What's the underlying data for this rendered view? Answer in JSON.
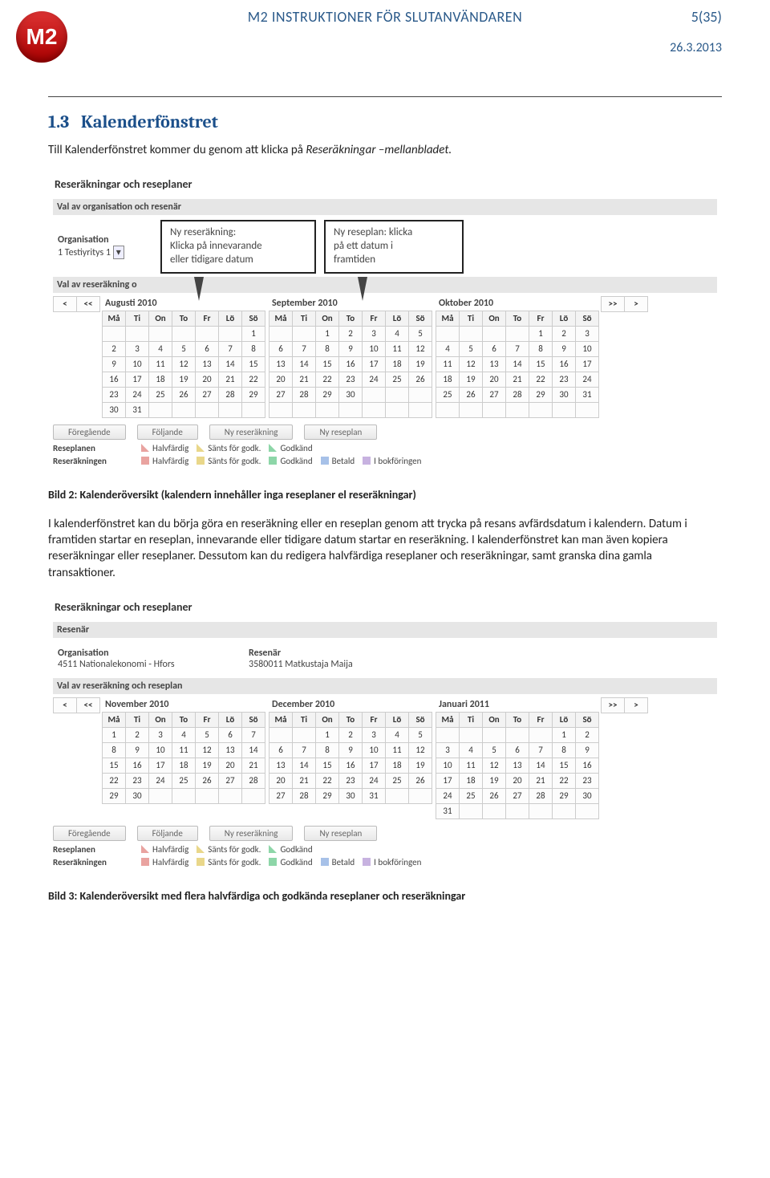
{
  "header": {
    "logo_text": "M2",
    "title": "M2 INSTRUKTIONER FÖR SLUTANVÄNDAREN",
    "page": "5(35)",
    "date": "26.3.2013"
  },
  "section": {
    "number": "1.3",
    "title": "Kalenderfönstret",
    "intro_pre": "Till Kalenderfönstret kommer du genom att klicka på ",
    "intro_em": "Reseräkningar –mellanbladet.",
    "intro_post": ""
  },
  "shot1": {
    "heading": "Reseräkningar och reseplaner",
    "subhead1": "Val av organisation och resenär",
    "org_label": "Organisation",
    "org_value": "1 Testiyritys 1",
    "pop1_l1": "Ny reseräkning:",
    "pop1_l2": "Klicka på innevarande",
    "pop1_l3": "eller tidigare datum",
    "pop2_l1": "Ny reseplan: klicka",
    "pop2_l2": "på ett datum i",
    "pop2_l3": "framtiden",
    "subhead2": "Val av reseräkning o",
    "months": [
      "Augusti 2010",
      "September 2010",
      "Oktober 2010"
    ],
    "dow": [
      "Må",
      "Ti",
      "On",
      "To",
      "Fr",
      "Lö",
      "Sö"
    ],
    "month_data": [
      [
        [
          "",
          "",
          "",
          "",
          "",
          "",
          "1"
        ],
        [
          "2",
          "3",
          "4",
          "5",
          "6",
          "7",
          "8"
        ],
        [
          "9",
          "10",
          "11",
          "12",
          "13",
          "14",
          "15"
        ],
        [
          "16",
          "17",
          "18",
          "19",
          "20",
          "21",
          "22"
        ],
        [
          "23",
          "24",
          "25",
          "26",
          "27",
          "28",
          "29"
        ],
        [
          "30",
          "31",
          "",
          "",
          "",
          "",
          ""
        ]
      ],
      [
        [
          "",
          "",
          "1",
          "2",
          "3",
          "4",
          "5"
        ],
        [
          "6",
          "7",
          "8",
          "9",
          "10",
          "11",
          "12"
        ],
        [
          "13",
          "14",
          "15",
          "16",
          "17",
          "18",
          "19"
        ],
        [
          "20",
          "21",
          "22",
          "23",
          "24",
          "25",
          "26"
        ],
        [
          "27",
          "28",
          "29",
          "30",
          "",
          "",
          ""
        ],
        [
          "",
          "",
          "",
          "",
          "",
          "",
          ""
        ]
      ],
      [
        [
          "",
          "",
          "",
          "",
          "1",
          "2",
          "3"
        ],
        [
          "4",
          "5",
          "6",
          "7",
          "8",
          "9",
          "10"
        ],
        [
          "11",
          "12",
          "13",
          "14",
          "15",
          "16",
          "17"
        ],
        [
          "18",
          "19",
          "20",
          "21",
          "22",
          "23",
          "24"
        ],
        [
          "25",
          "26",
          "27",
          "28",
          "29",
          "30",
          "31"
        ],
        [
          "",
          "",
          "",
          "",
          "",
          "",
          ""
        ]
      ]
    ],
    "nav": {
      "first": "<",
      "prev": "<<",
      "next": ">>",
      "last": ">"
    },
    "buttons": [
      "Föregående",
      "Följande",
      "Ny reseräkning",
      "Ny reseplan"
    ],
    "legend_plan": {
      "label": "Reseplanen",
      "items": [
        [
          "#e9a3a0",
          "Halvfärdig"
        ],
        [
          "#e9d78a",
          "Sänts för godk."
        ],
        [
          "#8dd6a8",
          "Godkänd"
        ]
      ]
    },
    "legend_bill": {
      "label": "Reseräkningen",
      "items": [
        [
          "#e9a3a0",
          "Halvfärdig"
        ],
        [
          "#e9d78a",
          "Sänts för godk."
        ],
        [
          "#8dd6a8",
          "Godkänd"
        ],
        [
          "#a7c1e8",
          "Betald"
        ],
        [
          "#c7b2e0",
          "I bokföringen"
        ]
      ]
    }
  },
  "caption1": "Bild 2: Kalenderöversikt (kalendern innehåller inga reseplaner el reseräkningar)",
  "para": "I kalenderfönstret kan du börja göra en reseräkning eller en reseplan genom att trycka på resans avfärdsdatum i kalendern. Datum i framtiden startar en reseplan, innevarande eller tidigare datum startar en reseräkning. I kalenderfönstret kan man även kopiera reseräkningar eller reseplaner. Dessutom kan du redigera halvfärdiga reseplaner och reseräkningar, samt granska dina gamla transaktioner.",
  "shot2": {
    "heading": "Reseräkningar och reseplaner",
    "subhead1": "Resenär",
    "org_label": "Organisation",
    "org_value": "4511 Nationalekonomi - Hfors",
    "res_label": "Resenär",
    "res_value": "3580011 Matkustaja Maija",
    "subhead2": "Val av reseräkning och reseplan",
    "months": [
      "November 2010",
      "December 2010",
      "Januari 2011"
    ],
    "dow": [
      "Må",
      "Ti",
      "On",
      "To",
      "Fr",
      "Lö",
      "Sö"
    ],
    "month_data": [
      [
        [
          "1",
          "2",
          "3",
          "4",
          "5",
          "6",
          "7"
        ],
        [
          "8",
          "9",
          "10",
          "11",
          "12",
          "13",
          "14"
        ],
        [
          "15",
          "16",
          "17",
          "18",
          "19",
          "20",
          "21"
        ],
        [
          "22",
          "23",
          "24",
          "25",
          "26",
          "27",
          "28"
        ],
        [
          "29",
          "30",
          "",
          "",
          "",
          "",
          ""
        ]
      ],
      [
        [
          "",
          "",
          "1",
          "2",
          "3",
          "4",
          "5"
        ],
        [
          "6",
          "7",
          "8",
          "9",
          "10",
          "11",
          "12"
        ],
        [
          "13",
          "14",
          "15",
          "16",
          "17",
          "18",
          "19"
        ],
        [
          "20",
          "21",
          "22",
          "23",
          "24",
          "25",
          "26"
        ],
        [
          "27",
          "28",
          "29",
          "30",
          "31",
          "",
          ""
        ]
      ],
      [
        [
          "",
          "",
          "",
          "",
          "",
          "1",
          "2"
        ],
        [
          "3",
          "4",
          "5",
          "6",
          "7",
          "8",
          "9"
        ],
        [
          "10",
          "11",
          "12",
          "13",
          "14",
          "15",
          "16"
        ],
        [
          "17",
          "18",
          "19",
          "20",
          "21",
          "22",
          "23"
        ],
        [
          "24",
          "25",
          "26",
          "27",
          "28",
          "29",
          "30"
        ],
        [
          "31",
          "",
          "",
          "",
          "",
          "",
          ""
        ]
      ]
    ],
    "highlight": {
      "1": {
        "2": [
          "",
          "g",
          "g",
          "g",
          "",
          "",
          ""
        ],
        "3": [
          "",
          "",
          "",
          "r",
          "r",
          "r",
          "r"
        ],
        "4": [
          "r",
          "",
          "",
          "",
          "",
          "",
          ""
        ],
        "5": [
          "dg",
          "dg",
          "y",
          "y",
          "",
          ""
        ]
      },
      "2": {
        "1": [
          "",
          "r",
          "",
          "r",
          "",
          "r",
          ""
        ],
        "2": [
          "",
          "r",
          "r",
          "r",
          "r",
          "",
          ""
        ],
        "3": [
          "",
          "",
          "r",
          "r",
          "r",
          "",
          ""
        ],
        "4": [
          "",
          "r",
          "r",
          "r",
          "r",
          "r",
          "r"
        ],
        "5": [
          "r",
          "",
          "",
          "",
          "",
          "",
          ""
        ]
      }
    },
    "buttons": [
      "Föregående",
      "Följande",
      "Ny reseräkning",
      "Ny reseplan"
    ],
    "legend_plan": {
      "label": "Reseplanen",
      "items": [
        [
          "#e9a3a0",
          "Halvfärdig"
        ],
        [
          "#e9d78a",
          "Sänts för godk."
        ],
        [
          "#8dd6a8",
          "Godkänd"
        ]
      ]
    },
    "legend_bill": {
      "label": "Reseräkningen",
      "items": [
        [
          "#e9a3a0",
          "Halvfärdig"
        ],
        [
          "#e9d78a",
          "Sänts för godk."
        ],
        [
          "#8dd6a8",
          "Godkänd"
        ],
        [
          "#a7c1e8",
          "Betald"
        ],
        [
          "#c7b2e0",
          "I bokföringen"
        ]
      ]
    }
  },
  "caption2": "Bild 3: Kalenderöversikt med flera halvfärdiga och godkända reseplaner och reseräkningar"
}
